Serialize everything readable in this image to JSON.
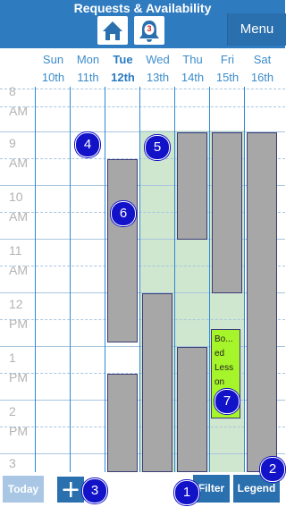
{
  "header": {
    "title": "Requests & Availability",
    "home_icon": "home-icon",
    "bell_icon": "bell-icon",
    "notification_count": "3",
    "menu_label": "Menu"
  },
  "days": [
    {
      "name": "Sun",
      "date": "10th"
    },
    {
      "name": "Mon",
      "date": "11th"
    },
    {
      "name": "Tue",
      "date": "12th"
    },
    {
      "name": "Wed",
      "date": "13th"
    },
    {
      "name": "Thu",
      "date": "14th"
    },
    {
      "name": "Fri",
      "date": "15th"
    },
    {
      "name": "Sat",
      "date": "16th"
    }
  ],
  "today_index": 2,
  "time_labels": [
    {
      "hour": "8",
      "ampm": "AM"
    },
    {
      "hour": "9",
      "ampm": "AM"
    },
    {
      "hour": "10",
      "ampm": "AM"
    },
    {
      "hour": "11",
      "ampm": "AM"
    },
    {
      "hour": "12",
      "ampm": "PM"
    },
    {
      "hour": "1",
      "ampm": "PM"
    },
    {
      "hour": "2",
      "ampm": "PM"
    },
    {
      "hour": "3",
      "ampm": "PM"
    }
  ],
  "booked_lesson": {
    "text_lines": [
      "Bo...",
      "ed",
      "Less",
      "on"
    ]
  },
  "badges": [
    "1",
    "2",
    "3",
    "4",
    "5",
    "6",
    "7"
  ],
  "footer": {
    "today_label": "Today",
    "add_icon": "plus-icon",
    "filter_label": "Filter",
    "legend_label": "Legend"
  },
  "colors": {
    "header": "#2f7bc0",
    "button": "#2a6fae",
    "available": "#cfe6cf",
    "event": "#a7a7a7",
    "booked": "#a6f42a",
    "badge": "#1212c8"
  }
}
